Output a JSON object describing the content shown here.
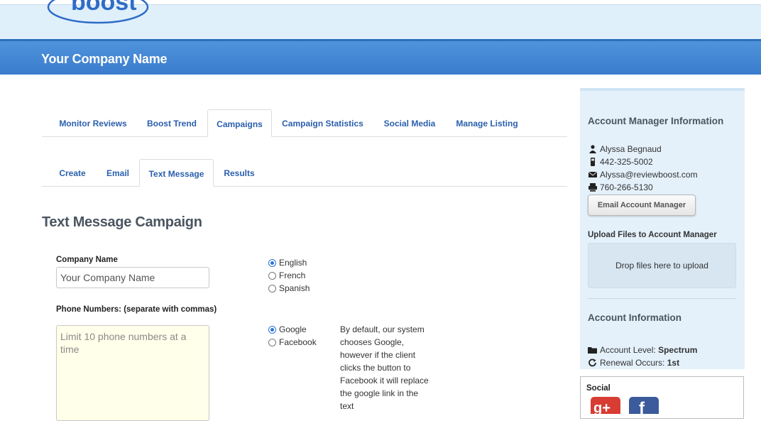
{
  "header": {
    "logo_text": "boost",
    "company_name": "Your Company Name"
  },
  "main_tabs": [
    {
      "label": "Monitor Reviews"
    },
    {
      "label": "Boost Trend"
    },
    {
      "label": "Campaigns"
    },
    {
      "label": "Campaign Statistics"
    },
    {
      "label": "Social Media"
    },
    {
      "label": "Manage Listing"
    }
  ],
  "sub_tabs": [
    {
      "label": "Create"
    },
    {
      "label": "Email"
    },
    {
      "label": "Text Message"
    },
    {
      "label": "Results"
    }
  ],
  "form": {
    "title": "Text Message Campaign",
    "company_name_label": "Company Name",
    "company_name_value": "Your Company Name",
    "languages": [
      "English",
      "French",
      "Spanish"
    ],
    "selected_language": "English",
    "phone_label": "Phone Numbers: (separate with commas)",
    "phone_placeholder": "Limit 10 phone numbers at a time",
    "review_sites": [
      "Google",
      "Facebook"
    ],
    "selected_review_site": "Google",
    "help_text": "By default, our system chooses Google, however if the client clicks the button to Facebook it will replace the google link in the text"
  },
  "sidebar": {
    "account_manager_heading": "Account Manager Information",
    "manager_name": "Alyssa Begnaud",
    "manager_phone": "442-325-5002",
    "manager_email": "Alyssa@reviewboost.com",
    "manager_fax": "760-266-5130",
    "email_button": "Email Account Manager",
    "upload_heading": "Upload Files to Account Manager",
    "dropzone_text": "Drop files here to upload",
    "account_info_heading": "Account Information",
    "account_level_label": "Account Level:",
    "account_level_value": "Spectrum",
    "renewal_label": "Renewal Occurs:",
    "renewal_value": "1st",
    "social_heading": "Social"
  },
  "colors": {
    "accent_blue": "#3a7ccd",
    "link_blue": "#2a5fad",
    "panel_bg": "#e4f1fb"
  }
}
